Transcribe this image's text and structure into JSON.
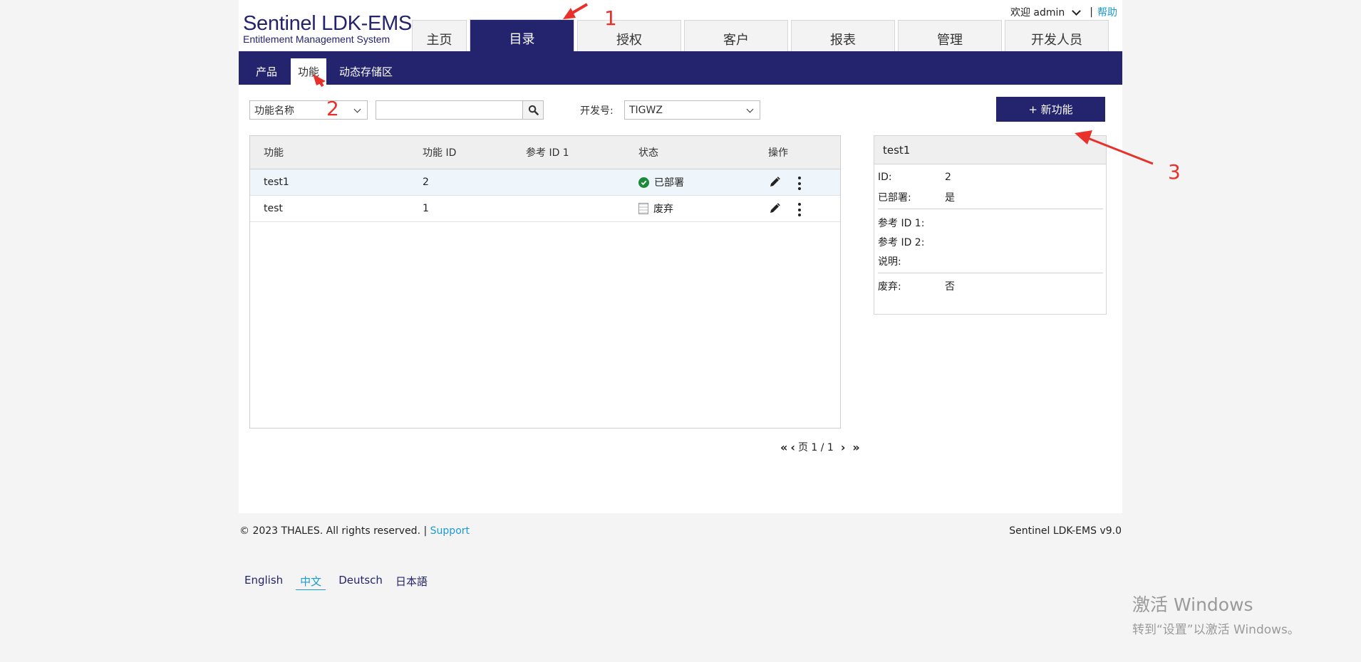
{
  "header": {
    "logo_line1": "Sentinel LDK-EMS",
    "logo_line2": "Entitlement Management System",
    "welcome": "欢迎 admin",
    "separator": "|",
    "help": "帮助"
  },
  "main_tabs": [
    {
      "label": "主页"
    },
    {
      "label": "目录",
      "active": true
    },
    {
      "label": "授权"
    },
    {
      "label": "客户"
    },
    {
      "label": "报表"
    },
    {
      "label": "管理"
    },
    {
      "label": "开发人员"
    }
  ],
  "sub_tabs": [
    {
      "label": "产品"
    },
    {
      "label": "功能",
      "active": true
    },
    {
      "label": "动态存储区"
    }
  ],
  "toolbar": {
    "filter_field": "功能名称",
    "search_value": "",
    "vendor_label": "开发号:",
    "vendor_value": "TIGWZ",
    "new_button": "+ 新功能"
  },
  "table": {
    "columns": [
      "功能",
      "功能 ID",
      "参考 ID 1",
      "状态",
      "操作"
    ],
    "rows": [
      {
        "name": "test1",
        "id": "2",
        "ref1": "",
        "status": "已部署",
        "status_type": "deployed",
        "selected": true
      },
      {
        "name": "test",
        "id": "1",
        "ref1": "",
        "status": "废弃",
        "status_type": "obsolete",
        "selected": false
      }
    ]
  },
  "pager": {
    "label": "页 1 / 1"
  },
  "detail": {
    "title": "test1",
    "fields": [
      {
        "key": "ID:",
        "value": "2"
      },
      {
        "key": "已部署:",
        "value": "是"
      },
      {
        "key": "参考 ID 1:",
        "value": ""
      },
      {
        "key": "参考 ID 2:",
        "value": ""
      },
      {
        "key": "说明:",
        "value": ""
      },
      {
        "key": "废弃:",
        "value": "否"
      }
    ]
  },
  "footer": {
    "copyright": "© 2023 THALES. All rights reserved. |",
    "support": "Support",
    "version": "Sentinel LDK-EMS v9.0",
    "languages": [
      {
        "label": "English"
      },
      {
        "label": "中文",
        "current": true
      },
      {
        "label": "Deutsch"
      },
      {
        "label": "日本語"
      }
    ]
  },
  "watermark": {
    "line1": "激活 Windows",
    "line2": "转到“设置”以激活 Windows。"
  },
  "annotations": [
    "1",
    "2",
    "3"
  ],
  "colors": {
    "brand_navy": "#23236e",
    "link_blue": "#1a9bd6",
    "annotation_red": "#e8312a",
    "deployed_green": "#1d8a3b"
  }
}
